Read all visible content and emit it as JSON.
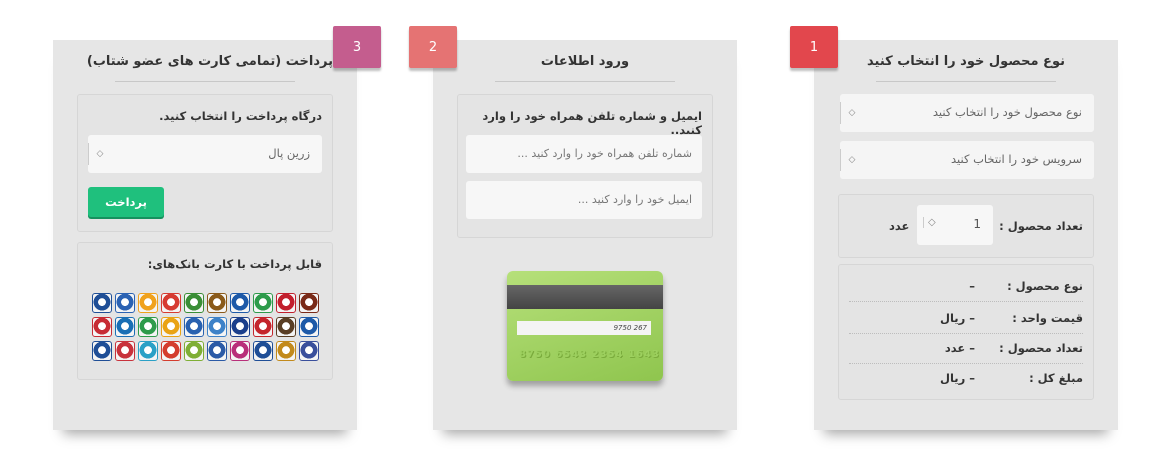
{
  "step1": {
    "number": "1",
    "title": "نوع محصول خود را انتخاب کنید",
    "product_type_placeholder": "نوع محصول خود را انتخاب کنید",
    "service_placeholder": "سرویس خود را انتخاب کنید",
    "quantity_label": "تعداد محصول :",
    "quantity_value": "1",
    "quantity_unit": "عدد",
    "summary": [
      {
        "key": "نوع محصول :",
        "value": "–"
      },
      {
        "key": "قیمت واحد :",
        "value": "– ریال"
      },
      {
        "key": "تعداد محصول :",
        "value": "– عدد"
      },
      {
        "key": "مبلغ کل :",
        "value": "– ریال"
      }
    ]
  },
  "step2": {
    "number": "2",
    "title": "ورود اطلاعات",
    "instruction": "ایمیل و شماره تلفن همراه خود را وارد کنید..",
    "phone_placeholder": "شماره تلفن همراه خود را وارد کنید ...",
    "email_placeholder": "ایمیل خود را وارد کنید ...",
    "card_signature": "9750 267",
    "card_number": "1643 2354 6543 8750"
  },
  "step3": {
    "number": "3",
    "title": "پرداخت (تمامی کارت های عضو شتاب)",
    "gateway_label": "درگاه پرداخت را انتخاب کنید.",
    "gateway_selected": "زرین پال",
    "pay_button": "پرداخت",
    "banks_label": "قابل پرداخت با کارت بانک‌های:",
    "bank_logo_colors": [
      "#1f4e96",
      "#2b62b3",
      "#f0a21d",
      "#d63b32",
      "#3a8e36",
      "#8a5a1a",
      "#1e5aa8",
      "#2e9b4b",
      "#c21f2d",
      "#7a2a18",
      "#c72b34",
      "#1a6fb5",
      "#2e9b4b",
      "#e9a316",
      "#2961b0",
      "#3e82c8",
      "#1b3f8c",
      "#c4252c",
      "#5a3e24",
      "#1e5aa8",
      "#1f4e96",
      "#c8323c",
      "#2aa0c6",
      "#d43d2e",
      "#7fae35",
      "#2b5aa6",
      "#b82f7a",
      "#1f4e96",
      "#c28a1c",
      "#3a4f9c"
    ]
  }
}
